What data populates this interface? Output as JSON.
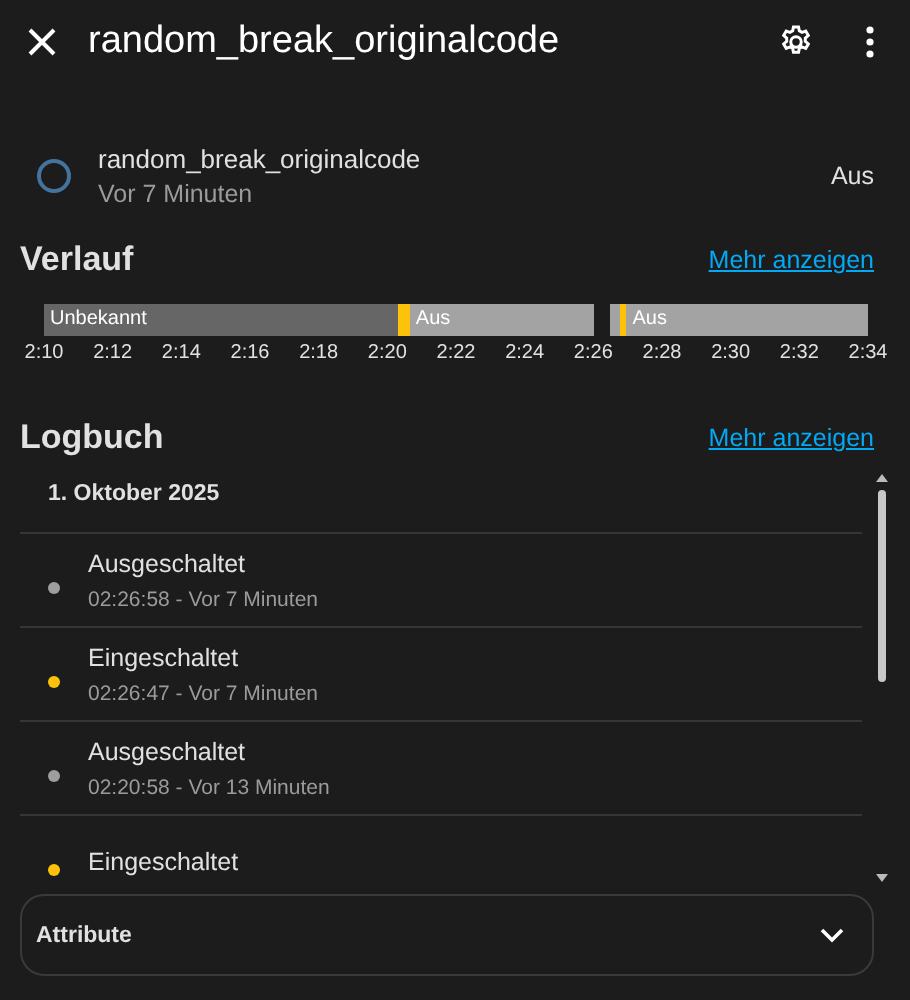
{
  "header": {
    "title": "random_break_originalcode"
  },
  "entity": {
    "name": "random_break_originalcode",
    "time": "Vor 7 Minuten",
    "state": "Aus",
    "on": false
  },
  "history": {
    "title": "Verlauf",
    "link": "Mehr anzeigen",
    "segments": [
      {
        "kind": "unknown",
        "label": "Unbekannt"
      },
      {
        "kind": "on"
      },
      {
        "kind": "off",
        "label": "Aus"
      },
      {
        "kind": "none"
      },
      {
        "kind": "off"
      },
      {
        "kind": "on"
      },
      {
        "kind": "off",
        "label": "Aus"
      }
    ],
    "ticks": [
      "2:10",
      "2:12",
      "2:14",
      "2:16",
      "2:18",
      "2:20",
      "2:22",
      "2:24",
      "2:26",
      "2:28",
      "2:30",
      "2:32",
      "2:34"
    ]
  },
  "logbook": {
    "title": "Logbuch",
    "link": "Mehr anzeigen",
    "date": "1. Oktober 2025",
    "entries": [
      {
        "message": "Ausgeschaltet",
        "time": "02:26:58 - Vor 7 Minuten",
        "on": false
      },
      {
        "message": "Eingeschaltet",
        "time": "02:26:47 - Vor 7 Minuten",
        "on": true
      },
      {
        "message": "Ausgeschaltet",
        "time": "02:20:58 - Vor 13 Minuten",
        "on": false
      },
      {
        "message": "Eingeschaltet",
        "on": true
      }
    ]
  },
  "attributes": {
    "title": "Attribute",
    "expanded": false
  }
}
